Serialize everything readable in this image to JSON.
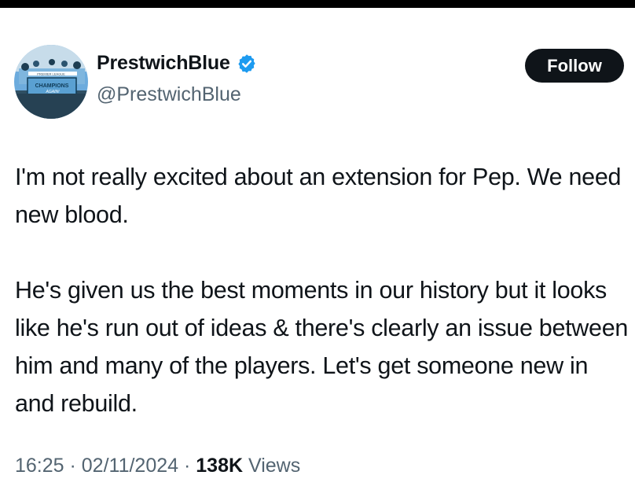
{
  "user": {
    "display_name": "PrestwichBlue",
    "handle": "@PrestwichBlue",
    "verified": true,
    "avatar_banner_text": "CHAMPIONS",
    "avatar_banner_subtext": "AGAIN!",
    "avatar_bus_text": "PREMIER LEAGUE",
    "colors": {
      "avatar_sky": "#6cabdd",
      "verified": "#1d9bf0"
    }
  },
  "follow_button": {
    "label": "Follow"
  },
  "tweet": {
    "paragraph_1": "I'm not really excited about an extension for Pep. We need new blood.",
    "paragraph_2": "He's given us the best moments in our history but it looks like he's run out of ideas & there's clearly an issue between him and many of the players. Let's get someone new in and rebuild."
  },
  "meta": {
    "time": "16:25",
    "sep1": " · ",
    "date": "02/11/2024",
    "sep2": " · ",
    "views_count": "138K",
    "views_label": " Views"
  }
}
